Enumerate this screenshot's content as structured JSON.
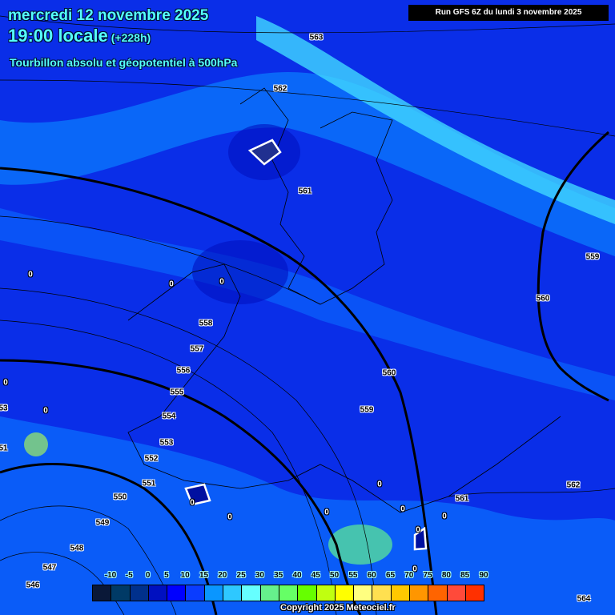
{
  "header": {
    "date": "mercredi 12 novembre 2025",
    "time": "19:00 locale",
    "lead": "(+228h)",
    "parameter": "Tourbillon absolu et géopotentiel à 500hPa",
    "run": "Run GFS 6Z du lundi 3 novembre 2025"
  },
  "contour_labels": [
    "563",
    "562",
    "561",
    "559",
    "560",
    "558",
    "557",
    "556",
    "560",
    "555",
    "559",
    "554",
    "553",
    "552",
    "562",
    "551",
    "561",
    "550",
    "549",
    "548",
    "547",
    "546",
    "564",
    "53",
    "51"
  ],
  "vorticity_zero_labels": [
    "0",
    "0",
    "0",
    "0",
    "0",
    "0",
    "0",
    "0",
    "0",
    "0",
    "0",
    "0",
    "0"
  ],
  "legend": {
    "ticks": [
      "-10",
      "-5",
      "0",
      "5",
      "10",
      "15",
      "20",
      "25",
      "30",
      "35",
      "40",
      "45",
      "50",
      "55",
      "60",
      "65",
      "70",
      "75",
      "80",
      "85",
      "90"
    ],
    "colors": [
      "#0a1838",
      "#003a66",
      "#00308c",
      "#0010c0",
      "#0000ff",
      "#0a3cff",
      "#0a96ff",
      "#2ec8ff",
      "#66ffff",
      "#66f08c",
      "#66ff66",
      "#66ff00",
      "#c0ff10",
      "#ffff00",
      "#ffff80",
      "#ffe050",
      "#ffc800",
      "#ff9600",
      "#ff6400",
      "#ff4a3a",
      "#ff3000"
    ]
  },
  "copyright": "Copyright 2025 Meteociel.fr"
}
